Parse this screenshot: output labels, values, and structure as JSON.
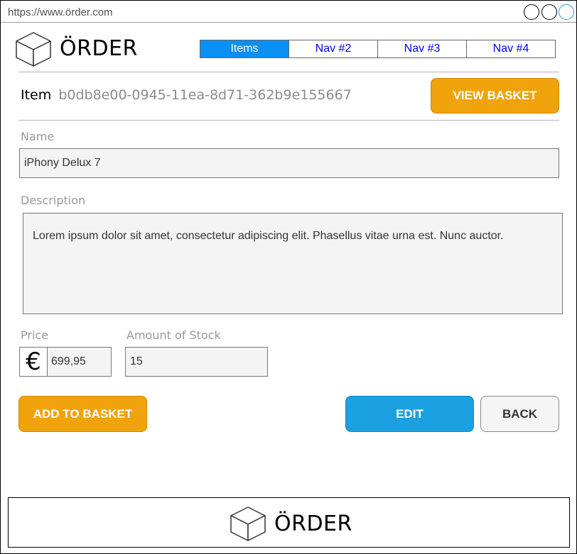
{
  "browser": {
    "url": "https://www.örder.com"
  },
  "header": {
    "brand": "ÖRDER",
    "logo_icon": "cube-icon",
    "nav": [
      {
        "label": "Items",
        "active": true
      },
      {
        "label": "Nav #2",
        "active": false
      },
      {
        "label": "Nav #3",
        "active": false
      },
      {
        "label": "Nav #4",
        "active": false
      }
    ]
  },
  "item": {
    "label": "Item",
    "id": "b0db8e00-0945-11ea-8d71-362b9e155667",
    "view_basket_label": "VIEW BASKET"
  },
  "form": {
    "name_label": "Name",
    "name_value": "iPhony Delux 7",
    "description_label": "Description",
    "description_value": "Lorem ipsum dolor sit amet, consectetur adipiscing elit. Phasellus vitae urna est. Nunc auctor.",
    "price_label": "Price",
    "currency_symbol": "€",
    "price_value": "699,95",
    "stock_label": "Amount of Stock",
    "stock_value": "15"
  },
  "actions": {
    "add_to_basket_label": "ADD TO BASKET",
    "edit_label": "EDIT",
    "back_label": "BACK"
  },
  "footer": {
    "brand": "ÖRDER",
    "logo_icon": "cube-icon"
  },
  "colors": {
    "accent_blue": "#1ba1e2",
    "nav_active": "#0a8ff5",
    "accent_orange": "#f0a30a"
  }
}
